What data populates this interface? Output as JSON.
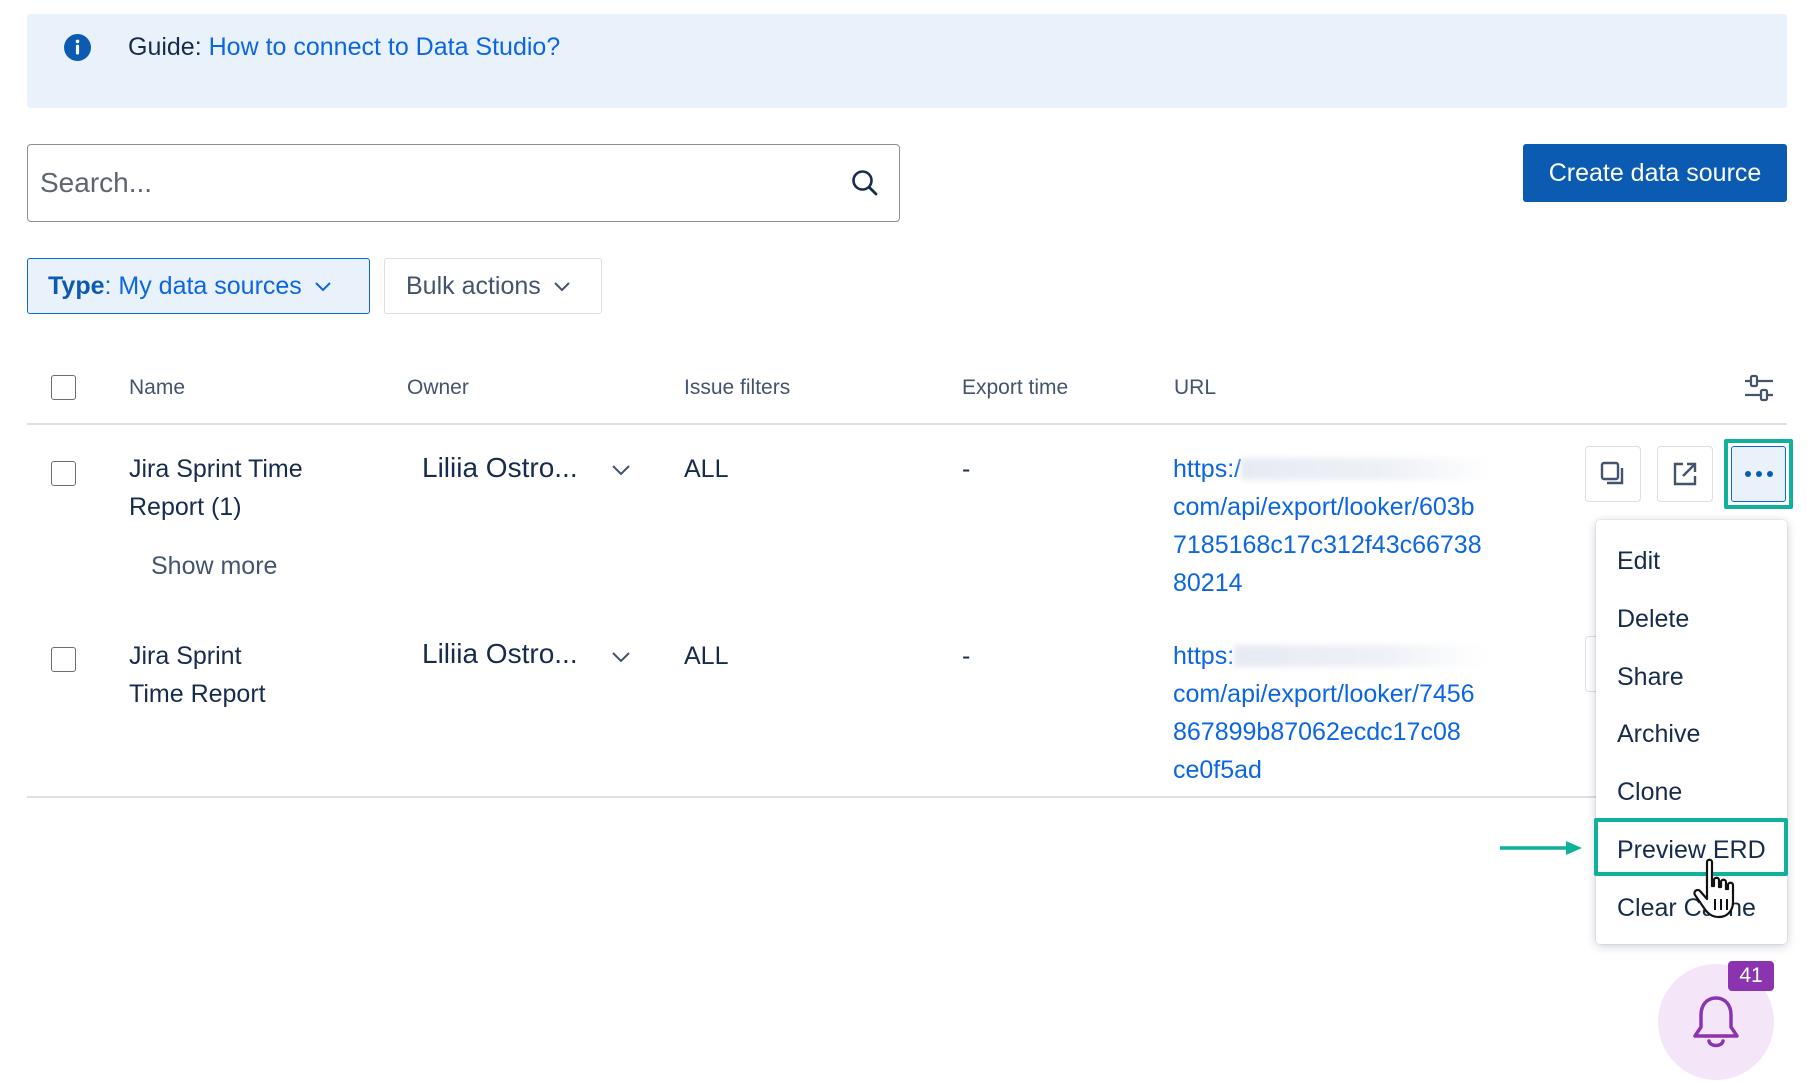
{
  "guide": {
    "prefix": "Guide: ",
    "link": "How to connect to Data Studio?"
  },
  "search": {
    "placeholder": "Search..."
  },
  "toolbar": {
    "create_label": "Create data source",
    "type_filter_label": "Type",
    "type_filter_sep": ":",
    "type_filter_value": " My data sources",
    "bulk_label": "Bulk actions"
  },
  "table": {
    "columns": [
      "Name",
      "Owner",
      "Issue filters",
      "Export time",
      "URL"
    ],
    "rows": [
      {
        "name_line1": "Jira Sprint Time",
        "name_line2": "Report (1)",
        "show_more": "Show more",
        "owner": "Liliia Ostro...",
        "issue_filters": "ALL",
        "export_time": "-",
        "url_start": "https:/",
        "url_lines": [
          "com/api/export/looker/603b",
          "7185168c17c312f43c66738",
          "80214"
        ]
      },
      {
        "name_line1": "Jira Sprint",
        "name_line2": "Time Report",
        "owner": "Liliia Ostro...",
        "issue_filters": "ALL",
        "export_time": "-",
        "url_start": "https:",
        "url_lines": [
          "com/api/export/looker/7456",
          "867899b87062ecdc17c08",
          "ce0f5ad"
        ]
      }
    ]
  },
  "menu": {
    "items": [
      "Edit",
      "Delete",
      "Share",
      "Archive",
      "Clone",
      "Preview ERD",
      "Clear Cache"
    ]
  },
  "notifications": {
    "count": "41"
  },
  "colors": {
    "accent": "#0c66e4",
    "primary_button": "#0c5bb3",
    "highlight": "#10b19b",
    "badge": "#8c34b0"
  }
}
